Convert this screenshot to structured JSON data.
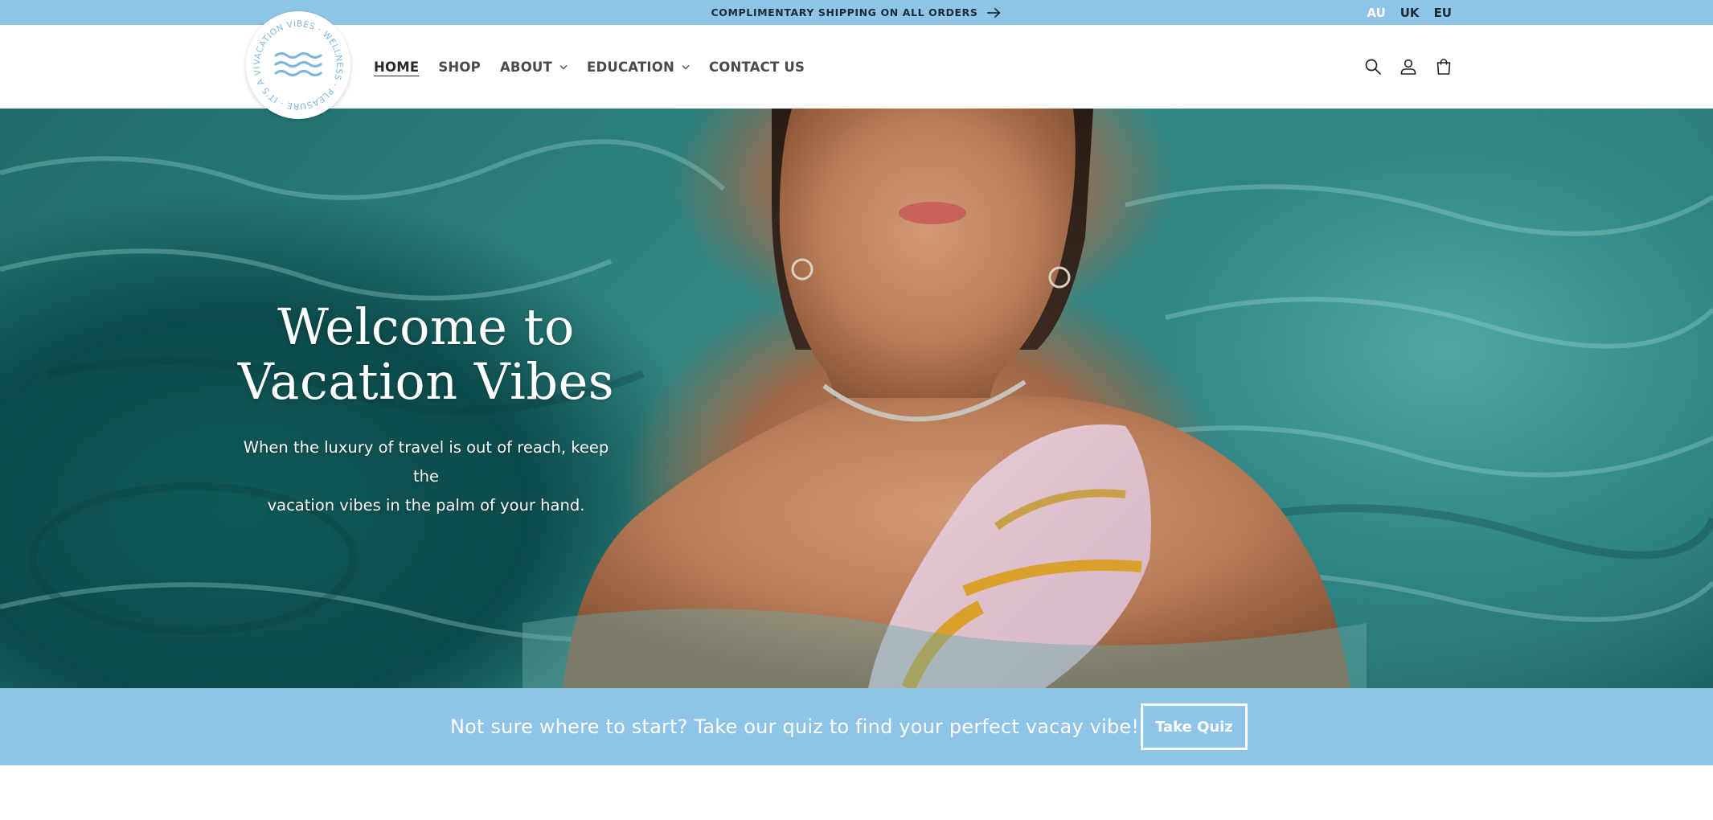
{
  "announcement": {
    "text": "COMPLIMENTARY SHIPPING ON ALL ORDERS",
    "arrow_icon": "arrow-right-icon"
  },
  "regions": [
    "AU",
    "UK",
    "EU"
  ],
  "region_active": "AU",
  "logo": {
    "ring_text": "VACATION VIBES · WELLNESS · PLEASURE · IT'S A VIBE ·",
    "icon": "waves-icon"
  },
  "nav": {
    "items": [
      {
        "label": "HOME",
        "active": true,
        "dropdown": false
      },
      {
        "label": "SHOP",
        "active": false,
        "dropdown": false
      },
      {
        "label": "ABOUT",
        "active": false,
        "dropdown": true
      },
      {
        "label": "EDUCATION",
        "active": false,
        "dropdown": true
      },
      {
        "label": "CONTACT US",
        "active": false,
        "dropdown": false
      }
    ]
  },
  "header_icons": [
    "search-icon",
    "account-icon",
    "cart-icon"
  ],
  "hero": {
    "title_line1": "Welcome to",
    "title_line2": "Vacation Vibes",
    "subtitle_line1": "When the luxury of travel is out of reach, keep the",
    "subtitle_line2": "vacation vibes in the palm of your hand."
  },
  "quiz": {
    "text": "Not sure where to start? Take our quiz to find your perfect vacay vibe!",
    "button_label": "Take Quiz"
  },
  "colors": {
    "accent_blue": "#8ec4e8",
    "logo_blue": "#7fb6dc",
    "water_teal": "#2b7f7c"
  }
}
